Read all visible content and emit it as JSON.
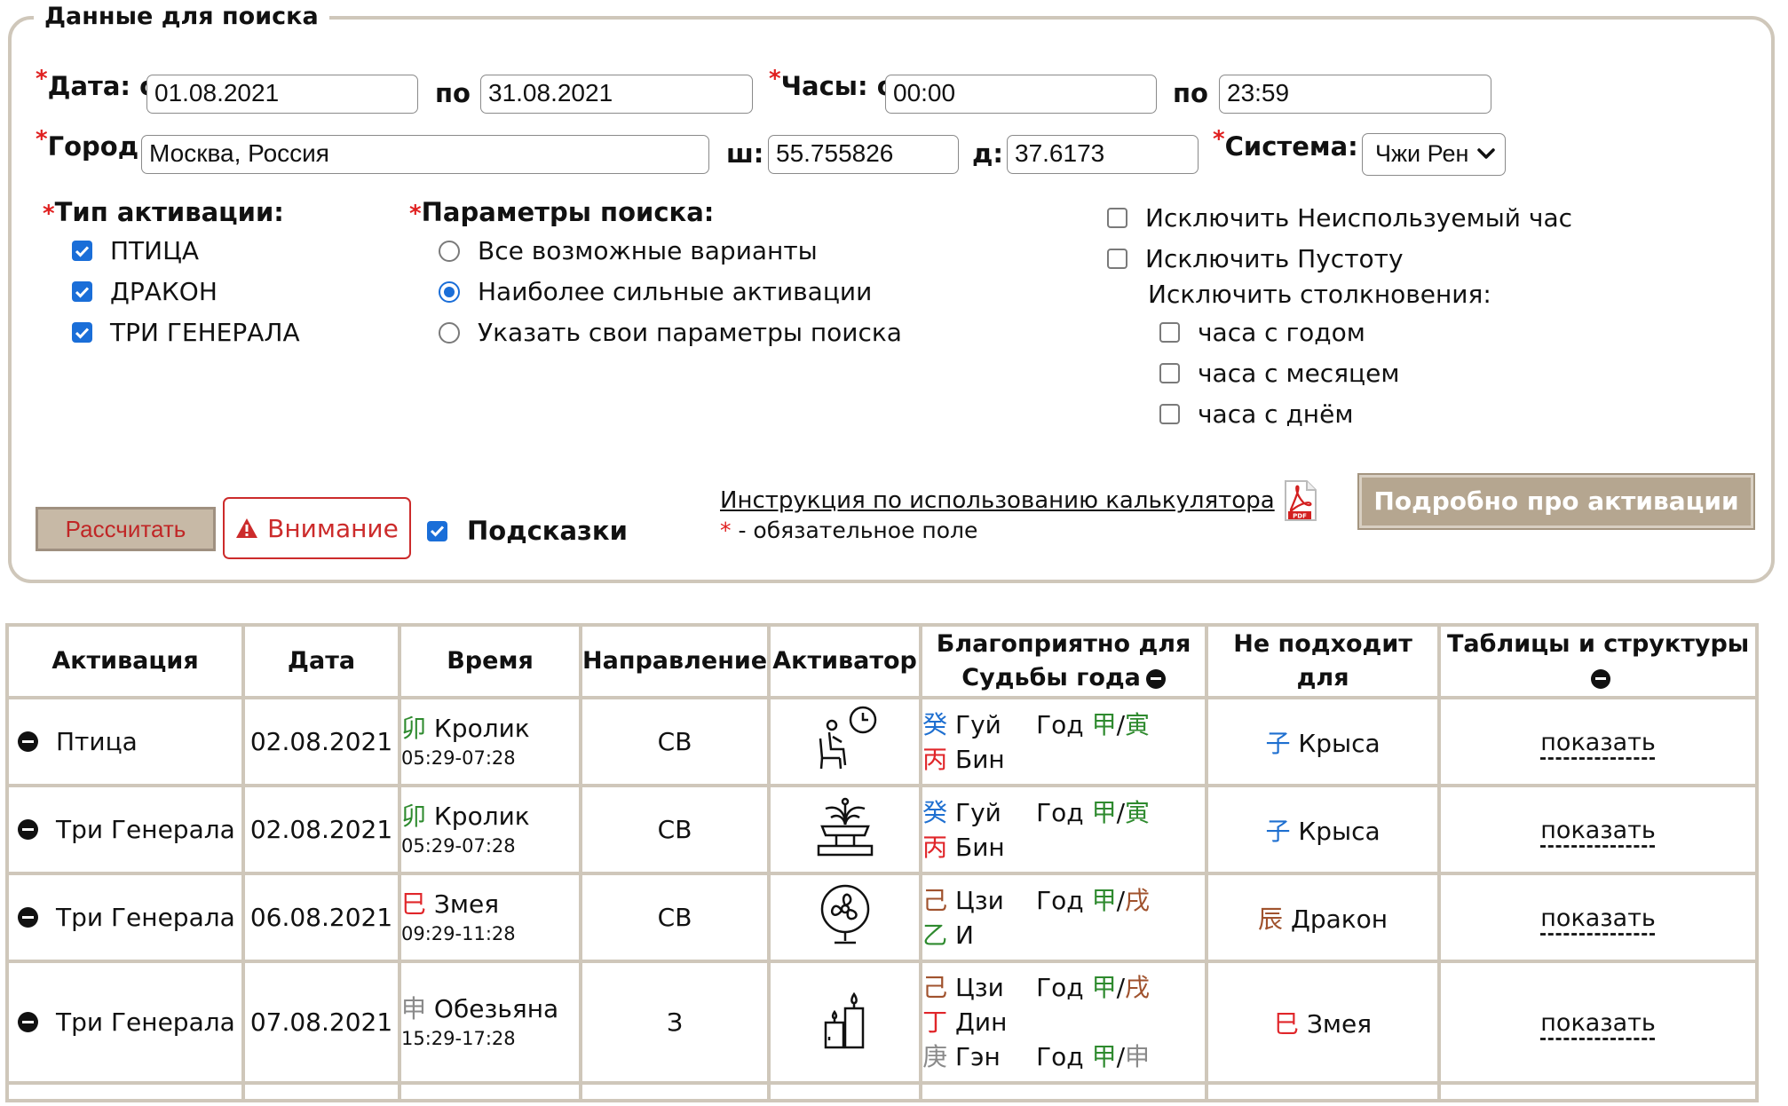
{
  "form": {
    "legend": "Данные для поиска",
    "required_mark": "*",
    "date_from_label": "Дата: с",
    "date_from": "01.08.2021",
    "date_to_label": "по",
    "date_to": "31.08.2021",
    "hours_from_label": "Часы: с",
    "hours_from": "00:00",
    "hours_to_label": "по",
    "hours_to": "23:59",
    "city_label": "Город:",
    "city": "Москва, Россия",
    "lat_label": "ш:",
    "lat": "55.755826",
    "lon_label": "д:",
    "lon": "37.6173",
    "system_label": "Система:",
    "system_value": "Чжи Рен",
    "activation_type_label": "Тип активации:",
    "activation_types": [
      {
        "label": "ПТИЦА",
        "checked": true
      },
      {
        "label": "ДРАКОН",
        "checked": true
      },
      {
        "label": "ТРИ ГЕНЕРАЛА",
        "checked": true
      }
    ],
    "search_params_label": "Параметры поиска:",
    "search_params": [
      {
        "label": "Все возможные варианты",
        "selected": false
      },
      {
        "label": "Наиболее сильные активации",
        "selected": true
      },
      {
        "label": "Указать свои параметры поиска",
        "selected": false
      }
    ],
    "exclude_unused_hour": "Исключить Неиспользуемый час",
    "exclude_void": "Исключить Пустоту",
    "exclude_clashes_label": "Исключить столкновения:",
    "clashes": [
      "часа с годом",
      "часа с месяцем",
      "часа с днём"
    ],
    "calc_button": "Рассчитать",
    "warning_button": "Внимание",
    "hints_label": "Подсказки",
    "instruction_link": "Инструкция по использованию калькулятора",
    "required_note": " - обязательное поле",
    "more_button": "Подробно про активации",
    "pdf_badge": "PDF"
  },
  "table": {
    "headers": {
      "activation": "Активация",
      "date": "Дата",
      "time": "Время",
      "direction": "Направление",
      "activator": "Активатор",
      "favorable_1": "Благоприятно для",
      "favorable_2": "Судьбы года",
      "unsuitable": "Не подходит для",
      "tables": "Таблицы и структуры"
    },
    "show_label": "показать",
    "year_label": "Год",
    "slash": "/",
    "rows": [
      {
        "activation": "Птица",
        "date": "02.08.2021",
        "time_hz": "卯",
        "time_name": "Кролик",
        "time_range": "05:29-07:28",
        "direction": "СВ",
        "activator_icon": "person-sitting-clock-icon",
        "fav": [
          {
            "hz": "癸",
            "name": "Гуй",
            "y1": "甲",
            "y2": "寅"
          },
          {
            "hz": "丙",
            "name": "Бин"
          }
        ],
        "bad_hz": "子",
        "bad_name": "Крыса"
      },
      {
        "activation": "Три Генерала",
        "date": "02.08.2021",
        "time_hz": "卯",
        "time_name": "Кролик",
        "time_range": "05:29-07:28",
        "direction": "СВ",
        "activator_icon": "fountain-icon",
        "fav": [
          {
            "hz": "癸",
            "name": "Гуй",
            "y1": "甲",
            "y2": "寅"
          },
          {
            "hz": "丙",
            "name": "Бин"
          }
        ],
        "bad_hz": "子",
        "bad_name": "Крыса"
      },
      {
        "activation": "Три Генерала",
        "date": "06.08.2021",
        "time_hz": "巳",
        "time_name": "Змея",
        "time_range": "09:29-11:28",
        "direction": "СВ",
        "activator_icon": "fan-icon",
        "fav": [
          {
            "hz": "己",
            "name": "Цзи",
            "y1": "甲",
            "y2": "戌"
          },
          {
            "hz": "乙",
            "name": "И"
          }
        ],
        "bad_hz": "辰",
        "bad_name": "Дракон"
      },
      {
        "activation": "Три Генерала",
        "date": "07.08.2021",
        "time_hz": "申",
        "time_name": "Обезьяна",
        "time_range": "15:29-17:28",
        "direction": "З",
        "activator_icon": "candles-icon",
        "fav": [
          {
            "hz": "己",
            "name": "Цзи",
            "y1": "甲",
            "y2": "戌"
          },
          {
            "hz": "丁",
            "name": "Дин"
          },
          {
            "hz": "庚",
            "name": "Гэн",
            "y1": "甲",
            "y2": "申"
          }
        ],
        "bad_hz": "巳",
        "bad_name": "Змея"
      }
    ]
  },
  "colors": {
    "border": "#cfc7ba",
    "accent_blue": "#1a6ed8",
    "required_red": "#e02020",
    "button_tan": "#b5a690"
  }
}
